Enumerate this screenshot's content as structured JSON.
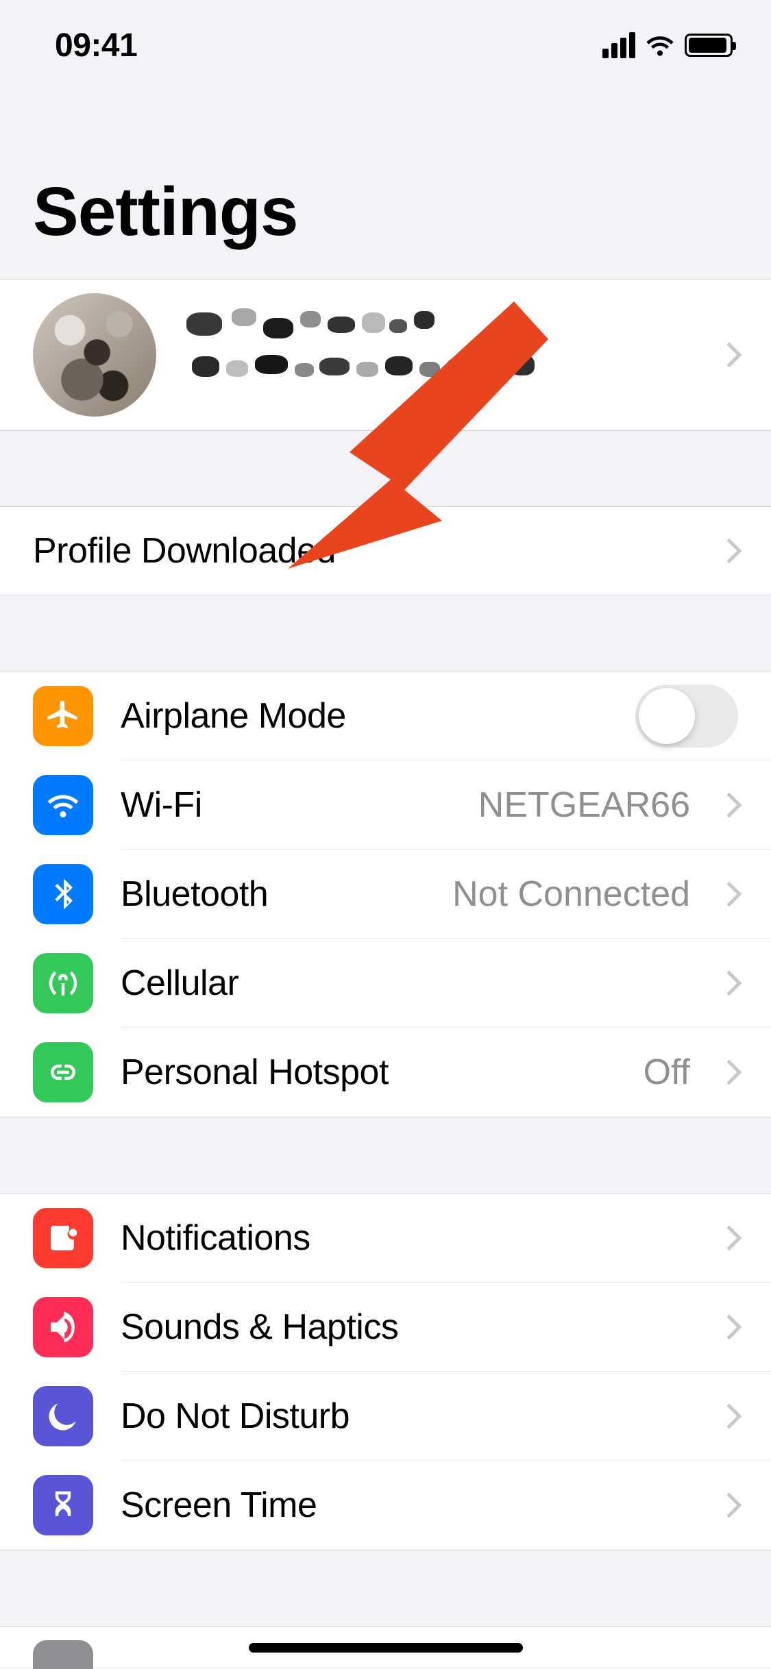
{
  "status": {
    "time": "09:41"
  },
  "title": "Settings",
  "profile_row": {
    "label": "Profile Downloaded"
  },
  "connectivity": {
    "airplane": {
      "label": "Airplane Mode",
      "on": false
    },
    "wifi": {
      "label": "Wi-Fi",
      "value": "NETGEAR66"
    },
    "bluetooth": {
      "label": "Bluetooth",
      "value": "Not Connected"
    },
    "cellular": {
      "label": "Cellular",
      "value": ""
    },
    "hotspot": {
      "label": "Personal Hotspot",
      "value": "Off"
    }
  },
  "alerts": {
    "notifications": {
      "label": "Notifications"
    },
    "sounds": {
      "label": "Sounds & Haptics"
    },
    "dnd": {
      "label": "Do Not Disturb"
    },
    "screentime": {
      "label": "Screen Time"
    }
  }
}
